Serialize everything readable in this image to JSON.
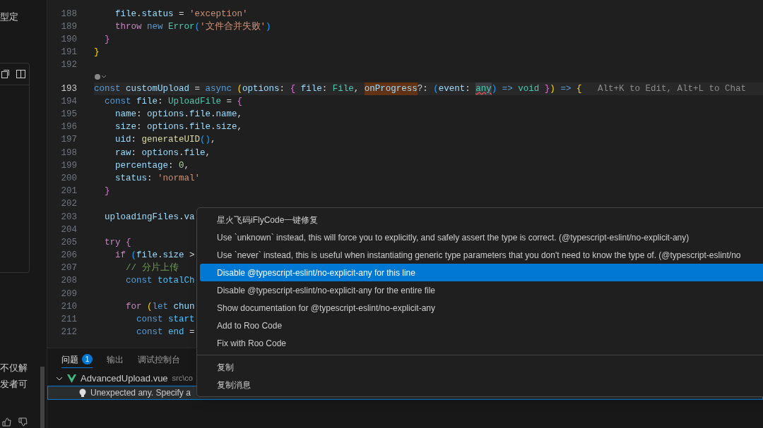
{
  "side_panel": {
    "texts": [
      "型定",
      "不仅解",
      "发者可"
    ]
  },
  "editor": {
    "lines": [
      {
        "number": "188",
        "tokens": [
          {
            "text": "    file",
            "kind": "var"
          },
          {
            "text": ".",
            "kind": "punct"
          },
          {
            "text": "status",
            "kind": "var"
          },
          {
            "text": " = ",
            "kind": "punct"
          },
          {
            "text": "'exception'",
            "kind": "str"
          }
        ]
      },
      {
        "number": "189",
        "tokens": [
          {
            "text": "    throw",
            "kind": "ctrl"
          },
          {
            "text": " new",
            "kind": "kw"
          },
          {
            "text": " Error",
            "kind": "type"
          },
          {
            "text": "(",
            "kind": "b3"
          },
          {
            "text": "'文件合并失败'",
            "kind": "str"
          },
          {
            "text": ")",
            "kind": "b3"
          }
        ]
      },
      {
        "number": "190",
        "tokens": [
          {
            "text": "  }",
            "kind": "b2"
          }
        ]
      },
      {
        "number": "191",
        "tokens": [
          {
            "text": "}",
            "kind": "b1"
          }
        ]
      },
      {
        "number": "192"
      },
      {
        "number": "193",
        "current": true,
        "codelens": true,
        "tokens": [
          {
            "text": "const",
            "kind": "kw"
          },
          {
            "text": " customUpload",
            "kind": "var"
          },
          {
            "text": " = ",
            "kind": "punct"
          },
          {
            "text": "async",
            "kind": "kw"
          },
          {
            "text": " (",
            "kind": "b1"
          },
          {
            "text": "options",
            "kind": "var"
          },
          {
            "text": ": ",
            "kind": "punct"
          },
          {
            "text": "{",
            "kind": "b2"
          },
          {
            "text": " file",
            "kind": "var"
          },
          {
            "text": ": ",
            "kind": "punct"
          },
          {
            "text": "File",
            "kind": "type"
          },
          {
            "text": ", ",
            "kind": "punct"
          },
          {
            "text": "onProgress",
            "kind": "var",
            "highlighted": true
          },
          {
            "text": "?: ",
            "kind": "punct"
          },
          {
            "text": "(",
            "kind": "b3"
          },
          {
            "text": "event",
            "kind": "var"
          },
          {
            "text": ": ",
            "kind": "punct"
          },
          {
            "text": "any",
            "kind": "type",
            "error": true
          },
          {
            "text": ")",
            "kind": "b3"
          },
          {
            "text": " => ",
            "kind": "kw"
          },
          {
            "text": "void",
            "kind": "type"
          },
          {
            "text": " }",
            "kind": "b2"
          },
          {
            "text": ")",
            "kind": "b1"
          },
          {
            "text": " => ",
            "kind": "kw"
          },
          {
            "text": "{",
            "kind": "b1"
          },
          {
            "text": "   Alt+K to Edit, Alt+L to Chat",
            "kind": "hint"
          }
        ]
      },
      {
        "number": "194",
        "tokens": [
          {
            "text": "  const",
            "kind": "kw"
          },
          {
            "text": " file",
            "kind": "var"
          },
          {
            "text": ": ",
            "kind": "punct"
          },
          {
            "text": "UploadFile",
            "kind": "type"
          },
          {
            "text": " = ",
            "kind": "punct"
          },
          {
            "text": "{",
            "kind": "b2"
          }
        ]
      },
      {
        "number": "195",
        "tokens": [
          {
            "text": "    name",
            "kind": "var"
          },
          {
            "text": ": ",
            "kind": "punct"
          },
          {
            "text": "options",
            "kind": "var"
          },
          {
            "text": ".",
            "kind": "punct"
          },
          {
            "text": "file",
            "kind": "var"
          },
          {
            "text": ".",
            "kind": "punct"
          },
          {
            "text": "name",
            "kind": "var"
          },
          {
            "text": ",",
            "kind": "punct"
          }
        ]
      },
      {
        "number": "196",
        "tokens": [
          {
            "text": "    size",
            "kind": "var"
          },
          {
            "text": ": ",
            "kind": "punct"
          },
          {
            "text": "options",
            "kind": "var"
          },
          {
            "text": ".",
            "kind": "punct"
          },
          {
            "text": "file",
            "kind": "var"
          },
          {
            "text": ".",
            "kind": "punct"
          },
          {
            "text": "size",
            "kind": "var"
          },
          {
            "text": ",",
            "kind": "punct"
          }
        ]
      },
      {
        "number": "197",
        "tokens": [
          {
            "text": "    uid",
            "kind": "var"
          },
          {
            "text": ": ",
            "kind": "punct"
          },
          {
            "text": "generateUID",
            "kind": "fn"
          },
          {
            "text": "()",
            "kind": "b3"
          },
          {
            "text": ",",
            "kind": "punct"
          }
        ]
      },
      {
        "number": "198",
        "tokens": [
          {
            "text": "    raw",
            "kind": "var"
          },
          {
            "text": ": ",
            "kind": "punct"
          },
          {
            "text": "options",
            "kind": "var"
          },
          {
            "text": ".",
            "kind": "punct"
          },
          {
            "text": "file",
            "kind": "var"
          },
          {
            "text": ",",
            "kind": "punct"
          }
        ]
      },
      {
        "number": "199",
        "tokens": [
          {
            "text": "    percentage",
            "kind": "var"
          },
          {
            "text": ": ",
            "kind": "punct"
          },
          {
            "text": "0",
            "kind": "num"
          },
          {
            "text": ",",
            "kind": "punct"
          }
        ]
      },
      {
        "number": "200",
        "tokens": [
          {
            "text": "    status",
            "kind": "var"
          },
          {
            "text": ": ",
            "kind": "punct"
          },
          {
            "text": "'normal'",
            "kind": "str"
          }
        ]
      },
      {
        "number": "201",
        "tokens": [
          {
            "text": "  }",
            "kind": "b2"
          }
        ]
      },
      {
        "number": "202"
      },
      {
        "number": "203",
        "tokens": [
          {
            "text": "  uploadingFiles",
            "kind": "var"
          },
          {
            "text": ".",
            "kind": "punct"
          },
          {
            "text": "va",
            "kind": "var"
          }
        ]
      },
      {
        "number": "204"
      },
      {
        "number": "205",
        "tokens": [
          {
            "text": "  try",
            "kind": "ctrl"
          },
          {
            "text": " {",
            "kind": "b2"
          }
        ]
      },
      {
        "number": "206",
        "tokens": [
          {
            "text": "    if",
            "kind": "ctrl"
          },
          {
            "text": " (",
            "kind": "b3"
          },
          {
            "text": "file",
            "kind": "var"
          },
          {
            "text": ".",
            "kind": "punct"
          },
          {
            "text": "size",
            "kind": "var"
          },
          {
            "text": " >",
            "kind": "punct"
          }
        ]
      },
      {
        "number": "207",
        "tokens": [
          {
            "text": "      // 分片上传",
            "kind": "comment"
          }
        ]
      },
      {
        "number": "208",
        "tokens": [
          {
            "text": "      const",
            "kind": "kw"
          },
          {
            "text": " totalCh",
            "kind": "const"
          }
        ]
      },
      {
        "number": "209"
      },
      {
        "number": "210",
        "tokens": [
          {
            "text": "      for",
            "kind": "ctrl"
          },
          {
            "text": " (",
            "kind": "b1"
          },
          {
            "text": "let",
            "kind": "kw"
          },
          {
            "text": " chun",
            "kind": "var"
          }
        ]
      },
      {
        "number": "211",
        "tokens": [
          {
            "text": "        const",
            "kind": "kw"
          },
          {
            "text": " start",
            "kind": "const"
          }
        ]
      },
      {
        "number": "212",
        "tokens": [
          {
            "text": "        const",
            "kind": "kw"
          },
          {
            "text": " end",
            "kind": "const"
          },
          {
            "text": " =",
            "kind": "punct"
          }
        ]
      }
    ]
  },
  "context_menu": {
    "groups": [
      [
        {
          "label": "星火飞码iFlyCode一键修复",
          "selected": false
        },
        {
          "label": "Use `unknown` instead, this will force you to explicitly, and safely assert the type is correct. (@typescript-eslint/no-explicit-any)",
          "selected": false
        },
        {
          "label": "Use `never` instead, this is useful when instantiating generic type parameters that you don't need to know the type of. (@typescript-eslint/no",
          "selected": false
        },
        {
          "label": "Disable @typescript-eslint/no-explicit-any for this line",
          "selected": true
        },
        {
          "label": "Disable @typescript-eslint/no-explicit-any for the entire file",
          "selected": false
        },
        {
          "label": "Show documentation for @typescript-eslint/no-explicit-any",
          "selected": false
        },
        {
          "label": "Add to Roo Code",
          "selected": false
        },
        {
          "label": "Fix with Roo Code",
          "selected": false
        }
      ],
      [
        {
          "label": "复制",
          "selected": false
        },
        {
          "label": "复制消息",
          "selected": false
        }
      ]
    ]
  },
  "panel": {
    "tabs": [
      {
        "label": "问题",
        "selected": true,
        "badge": "1"
      },
      {
        "label": "输出",
        "selected": false
      },
      {
        "label": "调试控制台",
        "selected": false
      }
    ],
    "file": {
      "name": "AdvancedUpload.vue",
      "path": "src\\co",
      "expanded": true
    },
    "problem": {
      "message": "Unexpected any. Specify a",
      "selected": true
    }
  }
}
